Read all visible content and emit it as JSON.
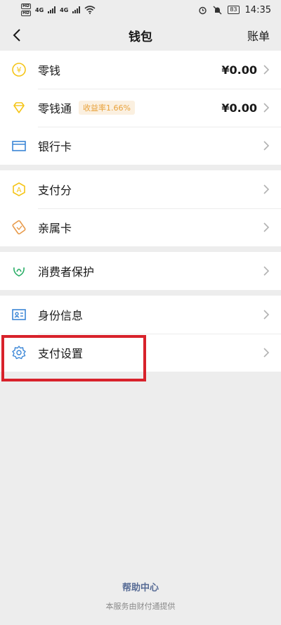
{
  "status": {
    "time": "14:35",
    "battery": "83",
    "net1": "HD",
    "net2": "HD",
    "g1": "4G",
    "g2": "4G"
  },
  "nav": {
    "title": "钱包",
    "right": "账单"
  },
  "groups": [
    [
      {
        "label": "零钱",
        "value": "¥0.00",
        "icon": "yuan-coin-icon"
      },
      {
        "label": "零钱通",
        "badge": "收益率1.66%",
        "value": "¥0.00",
        "icon": "diamond-icon"
      },
      {
        "label": "银行卡",
        "icon": "bank-card-icon"
      }
    ],
    [
      {
        "label": "支付分",
        "icon": "pay-score-icon"
      },
      {
        "label": "亲属卡",
        "icon": "family-card-icon"
      }
    ],
    [
      {
        "label": "消费者保护",
        "icon": "protection-icon"
      }
    ],
    [
      {
        "label": "身份信息",
        "icon": "id-card-icon"
      },
      {
        "label": "支付设置",
        "icon": "gear-icon"
      }
    ]
  ],
  "footer": {
    "help": "帮助中心",
    "provider": "本服务由财付通提供"
  },
  "colors": {
    "accent_yellow": "#f5c518",
    "accent_blue": "#3b86d6",
    "accent_green": "#2aae67",
    "accent_orange": "#e89a4a",
    "highlight_red": "#d8222b",
    "link": "#576b95"
  }
}
